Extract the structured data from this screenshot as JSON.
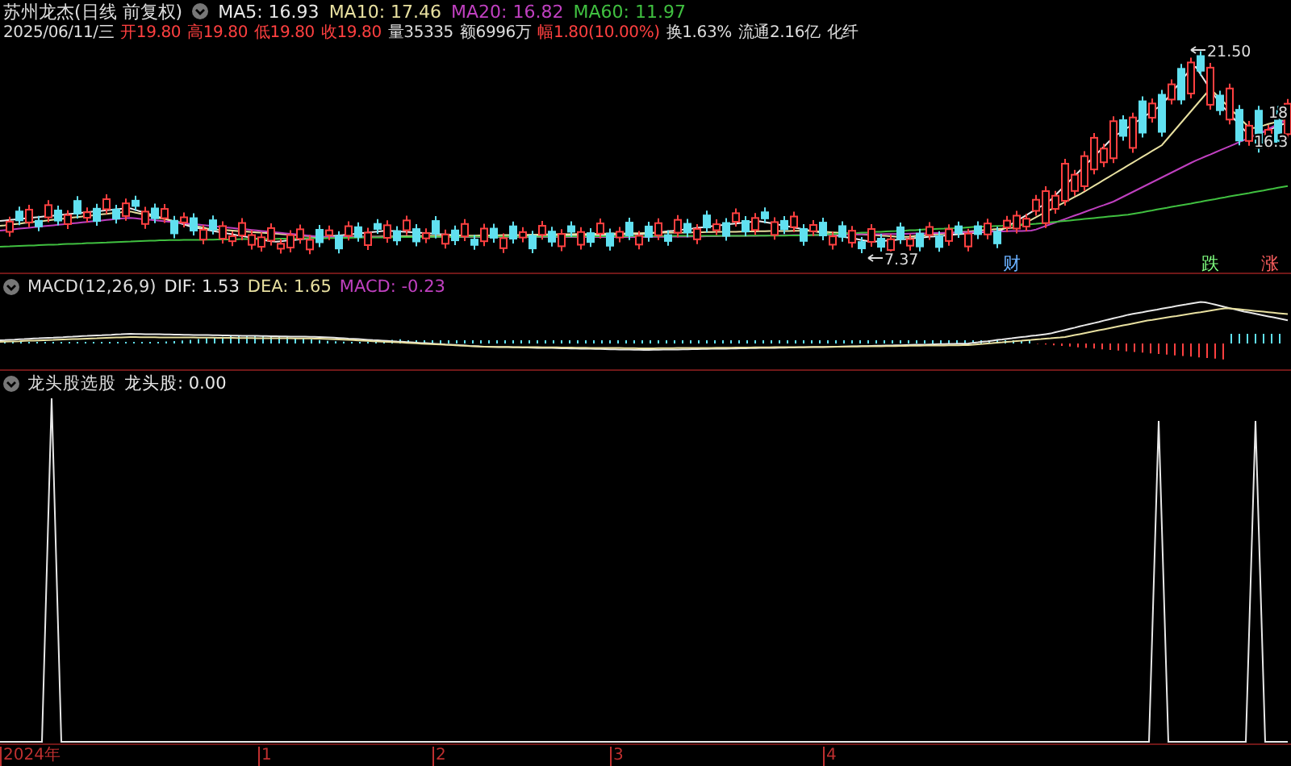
{
  "header": {
    "title": "苏州龙杰(日线 前复权)",
    "ma": [
      {
        "label": "MA5: 16.93",
        "color": "#e8e8e8"
      },
      {
        "label": "MA10: 17.46",
        "color": "#e8e0a0"
      },
      {
        "label": "MA20: 16.82",
        "color": "#c040c0"
      },
      {
        "label": "MA60: 11.97",
        "color": "#40c040"
      }
    ]
  },
  "quote": [
    {
      "text": "2025/06/11/三",
      "kind": "plain"
    },
    {
      "text": "开19.80",
      "kind": "up"
    },
    {
      "text": "高19.80",
      "kind": "up"
    },
    {
      "text": "低19.80",
      "kind": "up"
    },
    {
      "text": "收19.80",
      "kind": "up"
    },
    {
      "text": "量35335",
      "kind": "plain"
    },
    {
      "text": "额6996万",
      "kind": "plain"
    },
    {
      "text": "幅1.80(10.00%)",
      "kind": "up"
    },
    {
      "text": "换1.63%",
      "kind": "plain"
    },
    {
      "text": "流通2.16亿",
      "kind": "plain"
    },
    {
      "text": "化纤",
      "kind": "plain"
    }
  ],
  "price_panel": {
    "annotations": [
      {
        "text": "21.50",
        "kind": "high"
      },
      {
        "text": "7.37",
        "kind": "low"
      },
      {
        "text": "18",
        "kind": "edge_upper"
      },
      {
        "text": "16.3",
        "kind": "edge_lower"
      }
    ],
    "events": [
      {
        "text": "财",
        "kind": "finance"
      },
      {
        "text": "跌",
        "kind": "down"
      },
      {
        "text": "涨",
        "kind": "up"
      }
    ]
  },
  "macd_panel": {
    "title": "MACD(12,26,9)",
    "values": [
      {
        "label": "DIF: 1.53",
        "color": "#e8e8e8"
      },
      {
        "label": "DEA: 1.65",
        "color": "#e8e0a0"
      },
      {
        "label": "MACD: -0.23",
        "color": "#c040c0"
      }
    ]
  },
  "indicator_panel": {
    "title": "龙头股选股",
    "values": [
      {
        "label": "龙头股: 0.00",
        "color": "#e8e8e8"
      }
    ]
  },
  "time_axis": [
    "2024年",
    "1",
    "2",
    "3",
    "4"
  ]
}
